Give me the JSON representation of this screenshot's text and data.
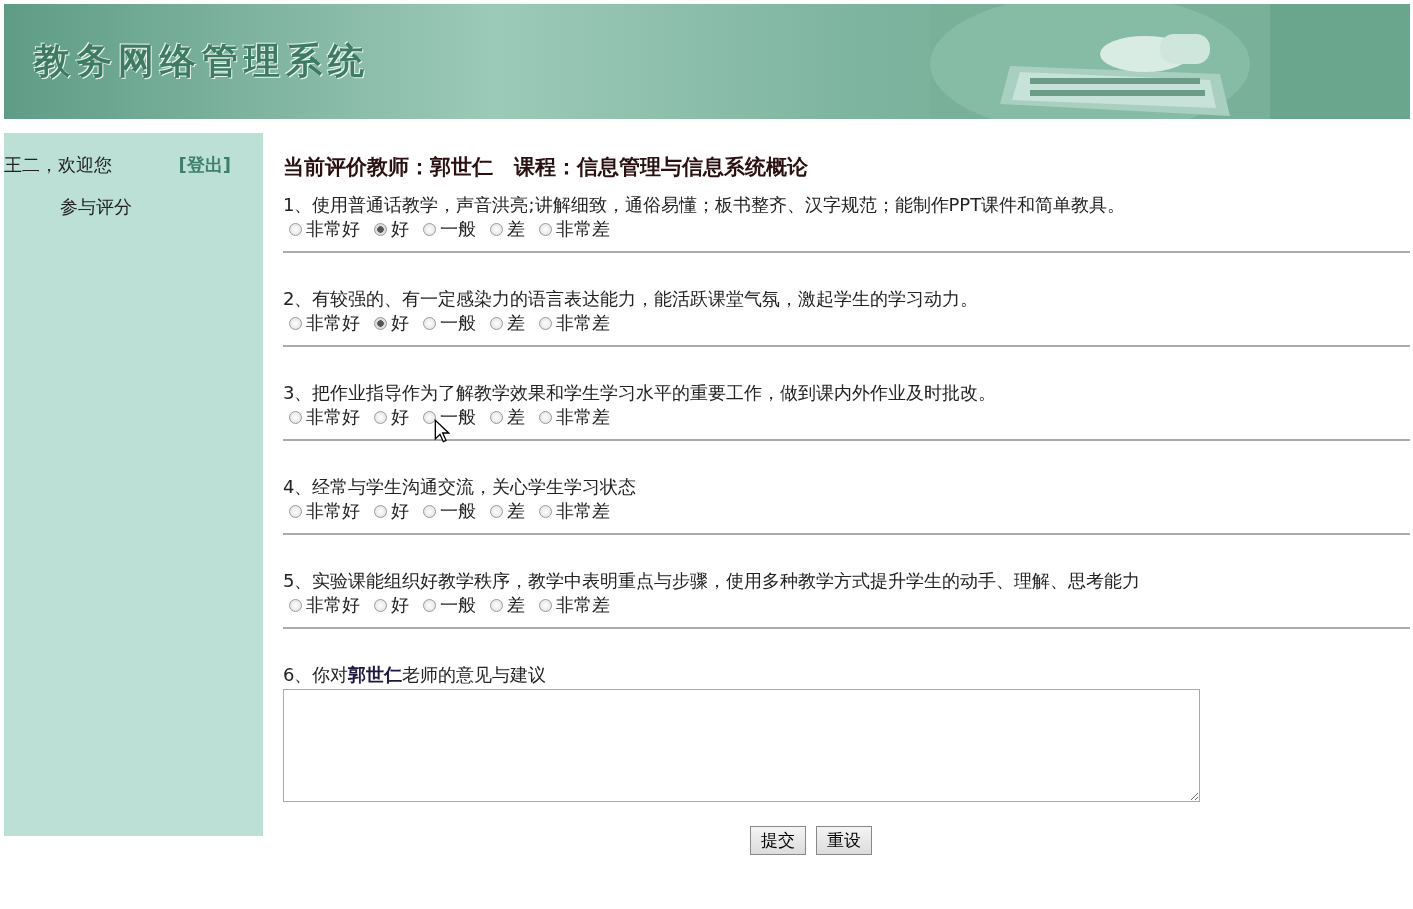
{
  "header": {
    "title": "教务网络管理系统"
  },
  "sidebar": {
    "greeting": "王二，欢迎您",
    "logout": "[登出]",
    "items": [
      {
        "label": "参与评分"
      }
    ]
  },
  "evaluation": {
    "title": "当前评价教师：郭世仁　课程：信息管理与信息系统概论",
    "questions": [
      {
        "text": "1、使用普通话教学，声音洪亮;讲解细致，通俗易懂；板书整齐、汉字规范；能制作PPT课件和简单教具。",
        "options": [
          {
            "label": "非常好",
            "selected": false
          },
          {
            "label": "好",
            "selected": true
          },
          {
            "label": "一般",
            "selected": false
          },
          {
            "label": "差",
            "selected": false
          },
          {
            "label": "非常差",
            "selected": false
          }
        ]
      },
      {
        "text": "2、有较强的、有一定感染力的语言表达能力，能活跃课堂气氛，激起学生的学习动力。",
        "options": [
          {
            "label": "非常好",
            "selected": false
          },
          {
            "label": "好",
            "selected": true
          },
          {
            "label": "一般",
            "selected": false
          },
          {
            "label": "差",
            "selected": false
          },
          {
            "label": "非常差",
            "selected": false
          }
        ]
      },
      {
        "text": "3、把作业指导作为了解教学效果和学生学习水平的重要工作，做到课内外作业及时批改。",
        "options": [
          {
            "label": "非常好",
            "selected": false
          },
          {
            "label": "好",
            "selected": false
          },
          {
            "label": "一般",
            "selected": false,
            "hovered": true
          },
          {
            "label": "差",
            "selected": false
          },
          {
            "label": "非常差",
            "selected": false
          }
        ]
      },
      {
        "text": "4、经常与学生沟通交流，关心学生学习状态",
        "options": [
          {
            "label": "非常好",
            "selected": false
          },
          {
            "label": "好",
            "selected": false
          },
          {
            "label": "一般",
            "selected": false
          },
          {
            "label": "差",
            "selected": false
          },
          {
            "label": "非常差",
            "selected": false
          }
        ]
      },
      {
        "text": "5、实验课能组织好教学秩序，教学中表明重点与步骤，使用多种教学方式提升学生的动手、理解、思考能力",
        "options": [
          {
            "label": "非常好",
            "selected": false
          },
          {
            "label": "好",
            "selected": false
          },
          {
            "label": "一般",
            "selected": false
          },
          {
            "label": "差",
            "selected": false
          },
          {
            "label": "非常差",
            "selected": false
          }
        ]
      }
    ],
    "comment_label": "6、你对**郭世仁**老师的意见与建议",
    "buttons": [
      "提交",
      "重设"
    ]
  }
}
